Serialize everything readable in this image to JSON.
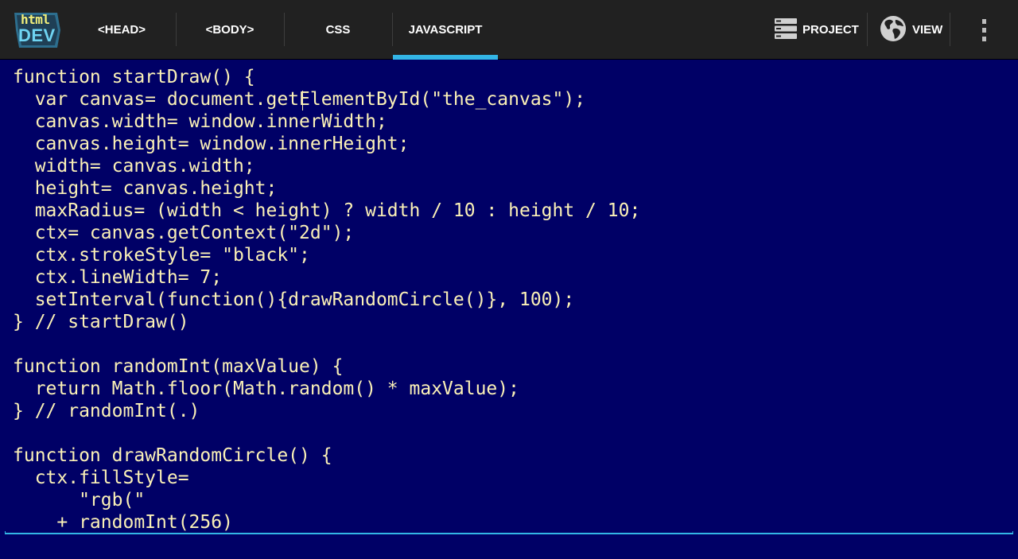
{
  "app": {
    "logo_top": "html",
    "logo_bottom": "DEV"
  },
  "tabs": [
    {
      "label": "<HEAD>",
      "active": false
    },
    {
      "label": "<BODY>",
      "active": false
    },
    {
      "label": "CSS",
      "active": false
    },
    {
      "label": "JAVASCRIPT",
      "active": true
    }
  ],
  "actions": {
    "project": {
      "label": "PROJECT",
      "icon": "server-stack-icon"
    },
    "view": {
      "label": "VIEW",
      "icon": "globe-icon"
    },
    "overflow": {
      "icon": "overflow-menu-icon"
    }
  },
  "editor": {
    "language": "JavaScript",
    "lines": [
      "function startDraw() {",
      "  var canvas= document.getElementById(\"the_canvas\");",
      "  canvas.width= window.innerWidth;",
      "  canvas.height= window.innerHeight;",
      "  width= canvas.width;",
      "  height= canvas.height;",
      "  maxRadius= (width < height) ? width / 10 : height / 10;",
      "  ctx= canvas.getContext(\"2d\");",
      "  ctx.strokeStyle= \"black\";",
      "  ctx.lineWidth= 7;",
      "  setInterval(function(){drawRandomCircle()}, 100);",
      "} // startDraw()",
      "",
      "function randomInt(maxValue) {",
      "  return Math.floor(Math.random() * maxValue);",
      "} // randomInt(.)",
      "",
      "function drawRandomCircle() {",
      "  ctx.fillStyle=",
      "      \"rgb(\"",
      "    + randomInt(256)"
    ]
  },
  "colors": {
    "toolbar_bg": "#212121",
    "editor_bg": "#000066",
    "code_text": "#fbf1b7",
    "accent": "#33b5e5"
  }
}
